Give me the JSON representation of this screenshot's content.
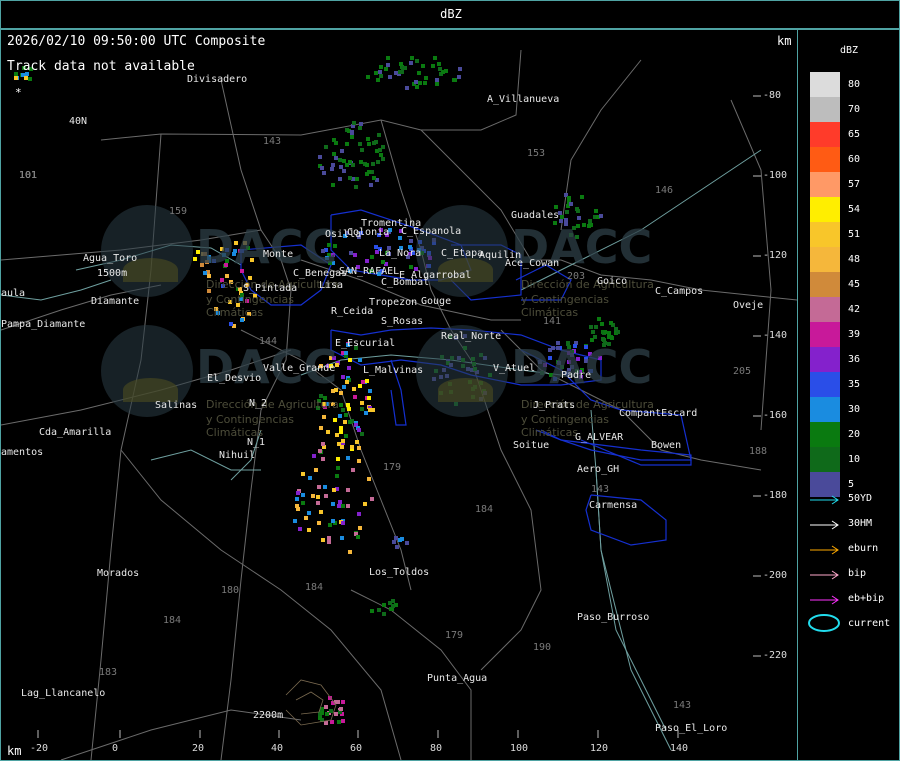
{
  "title": "dBZ",
  "map": {
    "timestamp": "2026/02/10 09:50:00 UTC Composite",
    "notice": "Track data not available",
    "km_top": "km",
    "km_bottom": "km",
    "star": "*"
  },
  "x_ticks": [
    "-20",
    "0",
    "20",
    "40",
    "60",
    "80",
    "100",
    "120",
    "140"
  ],
  "y_ticks": [
    "-80",
    "-100",
    "-120",
    "-140",
    "-160",
    "-180",
    "-200",
    "-220"
  ],
  "place_labels": [
    "Divisadero",
    "A_Villanueva",
    "40N",
    "101",
    "Agua_Toro",
    "1500m",
    "Diamante",
    "aula",
    "Pampa_Diamante",
    "Guadales",
    "Tromentina",
    "Colonia",
    "C_Espanola",
    "Osilla",
    "La_Nora",
    "C_Etapa",
    "Aquilin",
    "Ace_Cowan",
    "Monte",
    "C_Benegas",
    "SAN_RAFAEL",
    "E_Algarrobal",
    "Goico",
    "C_Campos",
    "Oveje",
    "S_Pintada",
    "Lisa",
    "C_Bombal",
    "Tropezon",
    "Gouge",
    "R_Ceida",
    "S_Rosas",
    "E_Escurial",
    "Real_Norte",
    "Valle_Grande",
    "L_Malvinas",
    "V_Atuel",
    "Padre",
    "El_Desvio",
    "Salinas",
    "N_2",
    "J_Prats",
    "CompantEscard",
    "Cda_Amarilla",
    "N_1",
    "G_ALVEAR",
    "Bowen",
    "amentos",
    "Nihuil",
    "Soitue",
    "Aero_GH",
    "Carmensa",
    "Morados",
    "Los_Toldos",
    "Paso_Burroso",
    "Lag_Llancanelo",
    "Punta_Agua",
    "2200m",
    "Paso_El_Loro"
  ],
  "road_numbers": [
    "143",
    "153",
    "146",
    "159",
    "144",
    "203",
    "141",
    "179",
    "184",
    "180",
    "184",
    "183",
    "179",
    "190",
    "143",
    "143",
    "205",
    "184",
    "188",
    "101"
  ],
  "watermarks": [
    {
      "title": "DACC",
      "line1": "Dirección de Agricultura",
      "line2": "y Contingencias Climáticas"
    },
    {
      "title": "DACC",
      "line1": "Dirección de Agricultura",
      "line2": "y Contingencias Climáticas"
    },
    {
      "title": "DACC",
      "line1": "Dirección de Agricultura",
      "line2": "y Contingencias Climáticas"
    },
    {
      "title": "DACC",
      "line1": "Dirección de Agricultura",
      "line2": "y Contingencias Climáticas"
    }
  ],
  "legend": {
    "unit": "dBZ",
    "scale": [
      {
        "label": "80",
        "color": "#dcdcdc"
      },
      {
        "label": "70",
        "color": "#bdbdbd"
      },
      {
        "label": "65",
        "color": "#ff3b2a"
      },
      {
        "label": "60",
        "color": "#ff5b14"
      },
      {
        "label": "57",
        "color": "#ff9966"
      },
      {
        "label": "54",
        "color": "#ffee00"
      },
      {
        "label": "51",
        "color": "#f8c62a"
      },
      {
        "label": "48",
        "color": "#f5b73b"
      },
      {
        "label": "45",
        "color": "#d08a3a"
      },
      {
        "label": "42",
        "color": "#c46a96"
      },
      {
        "label": "39",
        "color": "#c8199a"
      },
      {
        "label": "36",
        "color": "#8421cc"
      },
      {
        "label": "35",
        "color": "#2a4ee8"
      },
      {
        "label": "30",
        "color": "#1a8ce0"
      },
      {
        "label": "20",
        "color": "#0a7a10"
      },
      {
        "label": "10",
        "color": "#0f6a1a"
      },
      {
        "label": "5",
        "color": "#4a4a9a"
      }
    ],
    "tracks": [
      {
        "label": "50YD",
        "color": "#22ddee"
      },
      {
        "label": "30HM",
        "color": "#ffffff"
      },
      {
        "label": "eburn",
        "color": "#ffaa00"
      },
      {
        "label": "bip",
        "color": "#ffaacc"
      },
      {
        "label": "eb+bip",
        "color": "#ff33ff"
      }
    ],
    "current_label": "current",
    "current_color": "#22ddee"
  }
}
